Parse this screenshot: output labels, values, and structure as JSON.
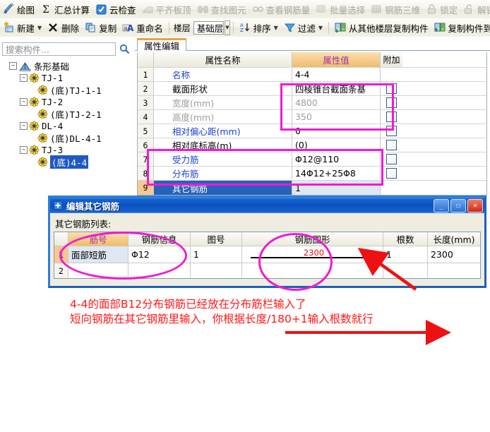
{
  "toolbar_top": [
    {
      "label": "绘图",
      "icon": "pencil-draw-icon",
      "enabled": true,
      "dropdown": false
    },
    {
      "label": "汇总计算",
      "icon": "sigma-icon",
      "enabled": true,
      "dropdown": false
    },
    {
      "label": "云检查",
      "icon": "cloud-check-icon",
      "enabled": true,
      "dropdown": false
    },
    {
      "label": "平齐板顶",
      "icon": "align-slab-top-icon",
      "enabled": false,
      "dropdown": false
    },
    {
      "label": "查找图元",
      "icon": "binoculars-icon",
      "enabled": false,
      "dropdown": false
    },
    {
      "label": "查看钢筋量",
      "icon": "view-rebar-qty-icon",
      "enabled": false,
      "dropdown": false
    },
    {
      "label": "批量选择",
      "icon": "batch-select-icon",
      "enabled": false,
      "dropdown": false
    },
    {
      "label": "钢筋三维",
      "icon": "rebar-3d-icon",
      "enabled": false,
      "dropdown": false
    },
    {
      "label": "锁定",
      "icon": "lock-icon",
      "enabled": false,
      "dropdown": false
    },
    {
      "label": "解锁",
      "icon": "unlock-icon",
      "enabled": false,
      "dropdown": false
    },
    {
      "label": "",
      "icon": "brush-icon",
      "enabled": true,
      "dropdown": false
    }
  ],
  "toolbar_second": {
    "items_left": [
      {
        "label": "新建",
        "icon": "new-item-icon",
        "dropdown": true
      },
      {
        "label": "删除",
        "icon": "delete-x-icon",
        "dropdown": false
      },
      {
        "label": "复制",
        "icon": "copy-icon",
        "dropdown": false
      },
      {
        "label": "重命名",
        "icon": "rename-icon",
        "dropdown": false
      }
    ],
    "floor_label": "楼层",
    "floor_value": "基础层",
    "items_right": [
      {
        "label": "排序",
        "icon": "sort-az-icon",
        "dropdown": true
      },
      {
        "label": "过滤",
        "icon": "filter-funnel-icon",
        "dropdown": true
      }
    ],
    "items_far": [
      {
        "label": "从其他楼层复制构件",
        "icon": "copy-from-floor-icon",
        "dropdown": false
      },
      {
        "label": "复制构件到其他",
        "icon": "copy-to-floor-icon",
        "dropdown": false
      }
    ]
  },
  "sidebar": {
    "search_placeholder": "搜索构件...",
    "search_icon": "search-icon",
    "tree": [
      {
        "label": "条形基础",
        "depth": 0,
        "expander": "minus",
        "icon": "foundation-icon",
        "selected": false
      },
      {
        "label": "TJ-1",
        "depth": 1,
        "expander": "minus",
        "icon": "flower-icon",
        "selected": false
      },
      {
        "label": "(底)TJ-1-1",
        "depth": 2,
        "expander": "leaf",
        "icon": "flower-icon",
        "selected": false
      },
      {
        "label": "TJ-2",
        "depth": 1,
        "expander": "minus",
        "icon": "flower-icon",
        "selected": false
      },
      {
        "label": "(底)TJ-2-1",
        "depth": 2,
        "expander": "leaf",
        "icon": "flower-icon",
        "selected": false
      },
      {
        "label": "DL-4",
        "depth": 1,
        "expander": "minus",
        "icon": "flower-icon",
        "selected": false
      },
      {
        "label": "(底)DL-4-1",
        "depth": 2,
        "expander": "leaf",
        "icon": "flower-icon",
        "selected": false
      },
      {
        "label": "TJ-3",
        "depth": 1,
        "expander": "minus",
        "icon": "flower-icon",
        "selected": false
      },
      {
        "label": "(底)4-4",
        "depth": 2,
        "expander": "leaf",
        "icon": "flower-icon",
        "selected": true
      }
    ]
  },
  "property_panel": {
    "tab_label": "属性编辑",
    "columns": [
      "",
      "属性名称",
      "属性值",
      "附加"
    ],
    "rows": [
      {
        "idx": "1",
        "name": "名称",
        "name_style": "blue",
        "value": "4-4",
        "value_style": "normal",
        "attach": false
      },
      {
        "idx": "2",
        "name": "截面形状",
        "name_style": "normal",
        "value": "四棱锥台截面条基",
        "value_style": "normal",
        "attach": true
      },
      {
        "idx": "3",
        "name": "宽度(mm)",
        "name_style": "gray",
        "value": "4800",
        "value_style": "gray",
        "attach": true
      },
      {
        "idx": "4",
        "name": "高度(mm)",
        "name_style": "gray",
        "value": "350",
        "value_style": "gray",
        "attach": true
      },
      {
        "idx": "5",
        "name": "相对偏心距(mm)",
        "name_style": "blue",
        "value": "0",
        "value_style": "normal",
        "attach": true
      },
      {
        "idx": "6",
        "name": "相对底标高(m)",
        "name_style": "normal",
        "value": "(0)",
        "value_style": "normal",
        "attach": true
      },
      {
        "idx": "7",
        "name": "受力筋",
        "name_style": "blue",
        "value": "Φ12@110",
        "value_style": "normal",
        "attach": true
      },
      {
        "idx": "8",
        "name": "分布筋",
        "name_style": "blue",
        "value": "14Φ12+25Φ8",
        "value_style": "normal",
        "attach": true
      },
      {
        "idx": "9",
        "name": "其它钢筋",
        "name_style": "normal",
        "value": "1",
        "value_style": "normal",
        "attach": false,
        "selected": true
      }
    ]
  },
  "dialog": {
    "title": "编辑其它钢筋",
    "title_icon": "rebar-dialog-icon",
    "minimize_label": "_",
    "maximize_label": "☐",
    "close_label": "✕",
    "list_label": "其它钢筋列表:",
    "columns": [
      "",
      "筋号",
      "钢筋信息",
      "图号",
      "钢筋图形",
      "根数",
      "长度(mm)"
    ],
    "rows": [
      {
        "idx": "1",
        "jinhao": "面部短筋",
        "info": "Φ12",
        "tuhao": "1",
        "shape_value": "2300",
        "genshu": "1",
        "changdu": "2300"
      },
      {
        "idx": "2",
        "jinhao": "",
        "info": "",
        "tuhao": "",
        "shape_value": "",
        "genshu": "",
        "changdu": ""
      }
    ]
  },
  "annotations": {
    "note_line1": "4-4的面部B12分布钢筋已经放在分布筋栏输入了",
    "note_line2": "短向钢筋在其它钢筋里输入，你根据长度/180+1输入根数就行",
    "note_color": "#ff1818",
    "highlight_color": "#f01ad3",
    "arrow_color": "#ee1111",
    "shapes": [
      {
        "kind": "rect",
        "name": "property-value-highlight-rect"
      },
      {
        "kind": "rect",
        "name": "rebar-rows-highlight-rect"
      },
      {
        "kind": "ellipse",
        "name": "jinhao-info-highlight-ellipse"
      },
      {
        "kind": "ellipse",
        "name": "rebar-shape-highlight-ellipse"
      },
      {
        "kind": "arrow",
        "name": "genshu-pointer-arrow"
      },
      {
        "kind": "arrow",
        "name": "note-pointer-arrow"
      }
    ]
  }
}
